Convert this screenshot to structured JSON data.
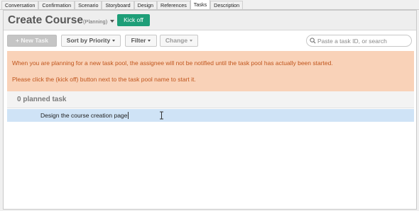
{
  "tabs": [
    {
      "label": "Conversation",
      "active": false
    },
    {
      "label": "Confirmation",
      "active": false
    },
    {
      "label": "Scenario",
      "active": false
    },
    {
      "label": "Storyboard",
      "active": false
    },
    {
      "label": "Design",
      "active": false
    },
    {
      "label": "References",
      "active": false
    },
    {
      "label": "Tasks",
      "active": true
    },
    {
      "label": "Description",
      "active": false
    }
  ],
  "header": {
    "title": "Create Course",
    "status": "(Planning)",
    "kickoff_label": "Kick off"
  },
  "toolbar": {
    "new_task_label": "+ New Task",
    "sort_label": "Sort by Priority",
    "filter_label": "Filter",
    "change_label": "Change",
    "search_placeholder": "Paste a task ID, or search",
    "search_value": ""
  },
  "notice": {
    "line1": "When you are planning for a new task pool, the assignee will not be notified until the task pool has actually been started.",
    "line2": "Please click the (kick off) button next to the task pool name to start it."
  },
  "section": {
    "label": "0 planned task"
  },
  "tasks": [
    {
      "name": "Design the course creation page"
    }
  ],
  "colors": {
    "kickoff": "#1e9e78",
    "notice_bg": "#f9d2b8",
    "notice_text": "#c0551c",
    "selected_row": "#cfe3f6"
  },
  "icons": {
    "search": "search-icon",
    "status_dropdown": "chevron-down-icon",
    "cursor": "text-cursor-icon"
  }
}
